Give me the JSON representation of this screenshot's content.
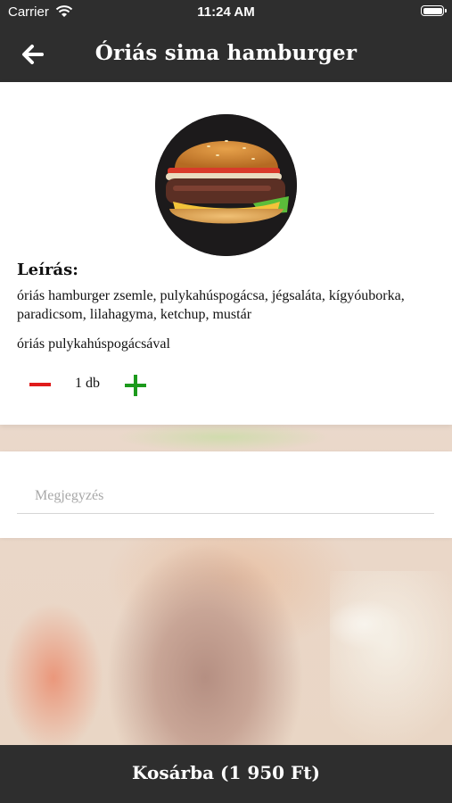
{
  "status_bar": {
    "carrier": "Carrier",
    "time": "11:24 AM"
  },
  "header": {
    "title": "Óriás sima hamburger",
    "back_icon": "arrow-left-icon"
  },
  "product": {
    "image": "burger-photo",
    "description_heading": "Leírás:",
    "description": "óriás hamburger zsemle, pulykahúspogácsa, jégsaláta, kígyóuborka, paradicsom, lilahagyma, ketchup, mustár",
    "description_extra": "óriás pulykahúspogácsával",
    "quantity": "1 db"
  },
  "note": {
    "placeholder": "Megjegyzés",
    "value": ""
  },
  "cart_button": {
    "label": "Kosárba (1 950 Ft)"
  },
  "colors": {
    "bar": "#2e2e2e",
    "minus": "#e01b1b",
    "plus": "#1c9a1c"
  }
}
